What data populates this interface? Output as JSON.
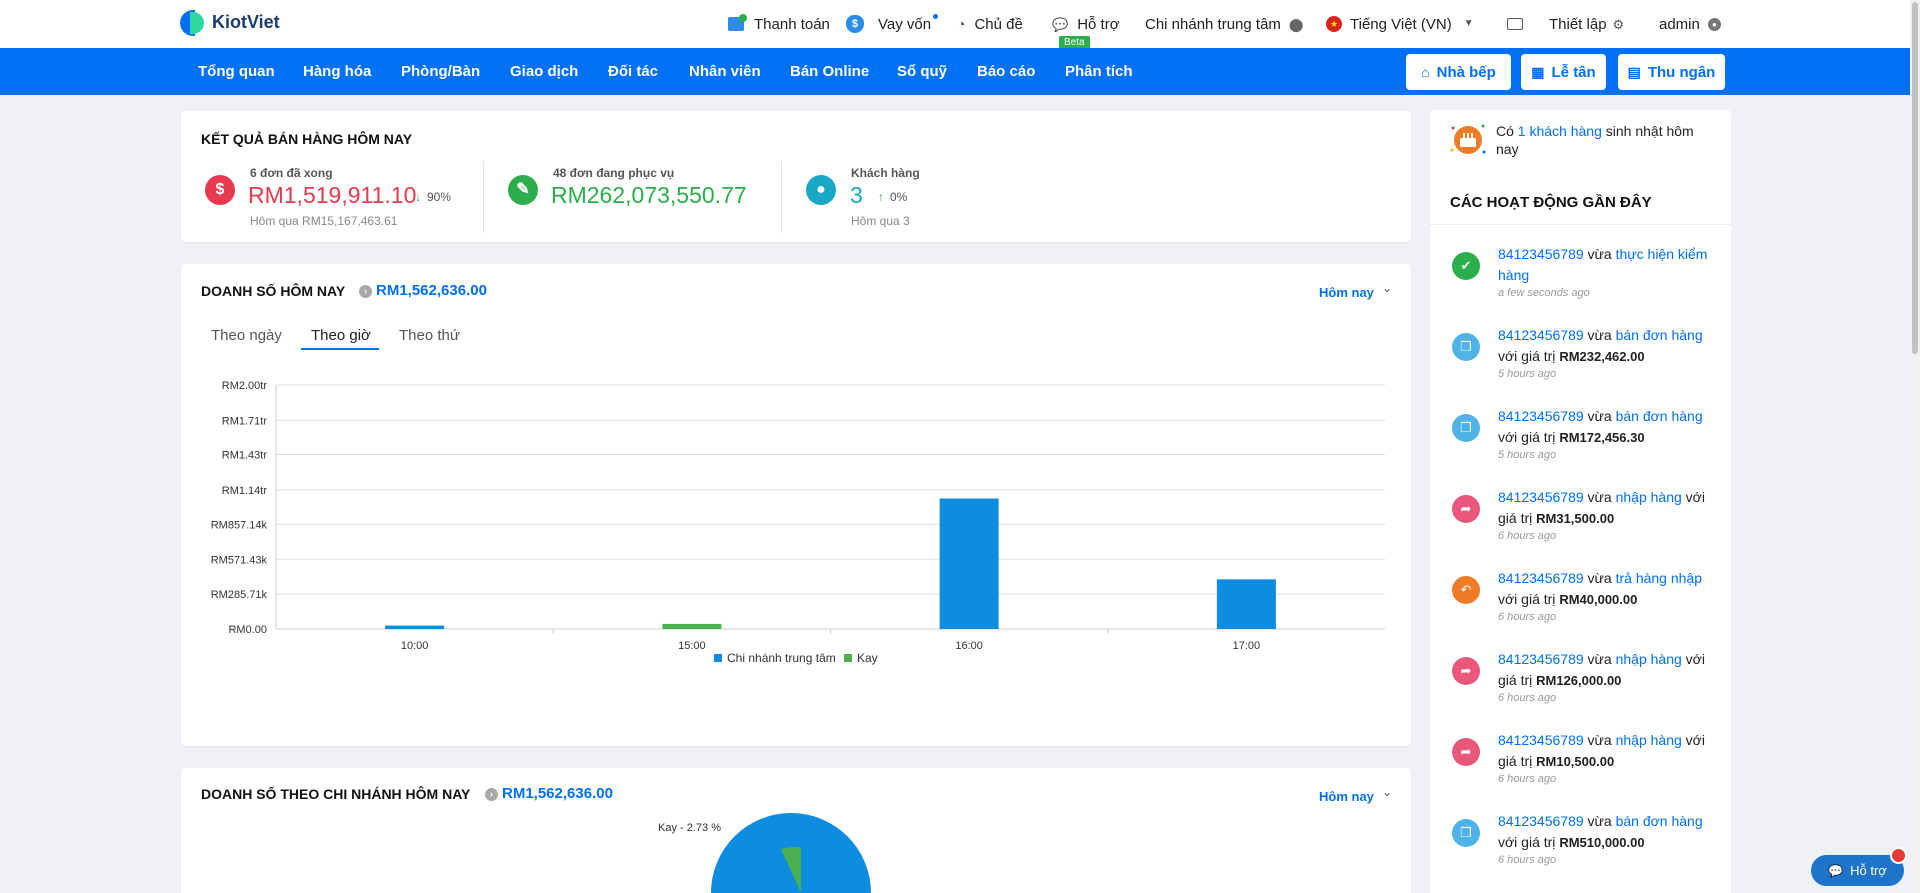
{
  "topbar": {
    "brand": "KiotViet",
    "payment": "Thanh toán",
    "loan": "Vay vốn",
    "theme": "Chủ đề",
    "support": "Hỗ trợ",
    "beta": "Beta",
    "branch": "Chi nhánh trung tâm",
    "language": "Tiếng Việt (VN)",
    "settings": "Thiết lập",
    "user": "admin"
  },
  "nav": {
    "items": [
      "Tổng quan",
      "Hàng hóa",
      "Phòng/Bàn",
      "Giao dịch",
      "Đối tác",
      "Nhân viên",
      "Bán Online",
      "Sổ quỹ",
      "Báo cáo",
      "Phân tích"
    ],
    "kitchen": "Nhà bếp",
    "reception": "Lễ tân",
    "cashier": "Thu ngân"
  },
  "sales_today": {
    "title": "KẾT QUẢ BÁN HÀNG HÔM NAY",
    "done": {
      "label": "6 đơn đã xong",
      "value": "RM1,519,911.10",
      "pct": "90%",
      "sub": "Hôm qua RM15,167,463.61"
    },
    "serving": {
      "label": "48 đơn đang phục vụ",
      "value": "RM262,073,550.77"
    },
    "customers": {
      "label": "Khách hàng",
      "value": "3",
      "pct": "0%",
      "sub": "Hôm qua 3"
    }
  },
  "revenue": {
    "title": "DOANH SỐ HÔM NAY",
    "amount": "RM1,562,636.00",
    "period": "Hôm nay",
    "tabs": [
      "Theo ngày",
      "Theo giờ",
      "Theo thứ"
    ],
    "active_tab": "Theo giờ"
  },
  "chart_data": {
    "type": "bar",
    "categories": [
      "10:00",
      "15:00",
      "16:00",
      "17:00"
    ],
    "series": [
      {
        "name": "Chi nhánh trung tâm",
        "color": "#0d8ce0",
        "values": [
          28000,
          0,
          1070000,
          407000
        ]
      },
      {
        "name": "Kay",
        "color": "#4caf50",
        "values": [
          0,
          42000,
          0,
          0
        ]
      }
    ],
    "ylim": [
      0,
      2000000
    ],
    "yticks": [
      "RM0.00",
      "RM285.71k",
      "RM571.43k",
      "RM857.14k",
      "RM1.14tr",
      "RM1.43tr",
      "RM1.71tr",
      "RM2.00tr"
    ],
    "ytick_values": [
      0,
      285710,
      571430,
      857140,
      1140000,
      1430000,
      1710000,
      2000000
    ],
    "legend_position": "bottom",
    "grid": true
  },
  "branch_revenue": {
    "title": "DOANH SỐ THEO CHI NHÁNH HÔM NAY",
    "amount": "RM1,562,636.00",
    "period": "Hôm nay",
    "pie_label": "Kay - 2.73 %"
  },
  "right_panel": {
    "birthday_prefix": "Có ",
    "birthday_link": "1 khách hàng",
    "birthday_suffix": " sinh nhật hôm nay",
    "activities_title": "CÁC HOẠT ĐỘNG GẦN ĐÂY",
    "activities": [
      {
        "user": "84123456789",
        "verb": " vừa ",
        "action": "thực hiện kiểm hàng",
        "mid": "",
        "value": "",
        "time": "a few seconds ago",
        "color": "#2dae4c",
        "icon": "check-icon"
      },
      {
        "user": "84123456789",
        "verb": " vừa ",
        "action": "bán đơn hàng",
        "mid": " với giá trị ",
        "value": "RM232,462.00",
        "time": "5 hours ago",
        "color": "#4fb3e8",
        "icon": "copy-icon"
      },
      {
        "user": "84123456789",
        "verb": " vừa ",
        "action": "bán đơn hàng",
        "mid": " với giá trị ",
        "value": "RM172,456.30",
        "time": "5 hours ago",
        "color": "#4fb3e8",
        "icon": "copy-icon"
      },
      {
        "user": "84123456789",
        "verb": " vừa ",
        "action": "nhập hàng",
        "mid": " với giá trị ",
        "value": "RM31,500.00",
        "time": "6 hours ago",
        "color": "#e9577a",
        "icon": "import-icon"
      },
      {
        "user": "84123456789",
        "verb": " vừa ",
        "action": "trả hàng nhập",
        "mid": " với giá trị ",
        "value": "RM40,000.00",
        "time": "6 hours ago",
        "color": "#f07b27",
        "icon": "return-icon"
      },
      {
        "user": "84123456789",
        "verb": " vừa ",
        "action": "nhập hàng",
        "mid": " với giá trị ",
        "value": "RM126,000.00",
        "time": "6 hours ago",
        "color": "#e9577a",
        "icon": "import-icon"
      },
      {
        "user": "84123456789",
        "verb": " vừa ",
        "action": "nhập hàng",
        "mid": " với giá trị ",
        "value": "RM10,500.00",
        "time": "6 hours ago",
        "color": "#e9577a",
        "icon": "import-icon"
      },
      {
        "user": "84123456789",
        "verb": " vừa ",
        "action": "bán đơn hàng",
        "mid": " với giá trị ",
        "value": "RM510,000.00",
        "time": "6 hours ago",
        "color": "#4fb3e8",
        "icon": "copy-icon"
      }
    ]
  },
  "help_button": "Hỗ trợ",
  "colors": {
    "primary": "#0070f4",
    "danger": "#e9394f",
    "success": "#2dae4c",
    "info": "#1aa9c4"
  }
}
